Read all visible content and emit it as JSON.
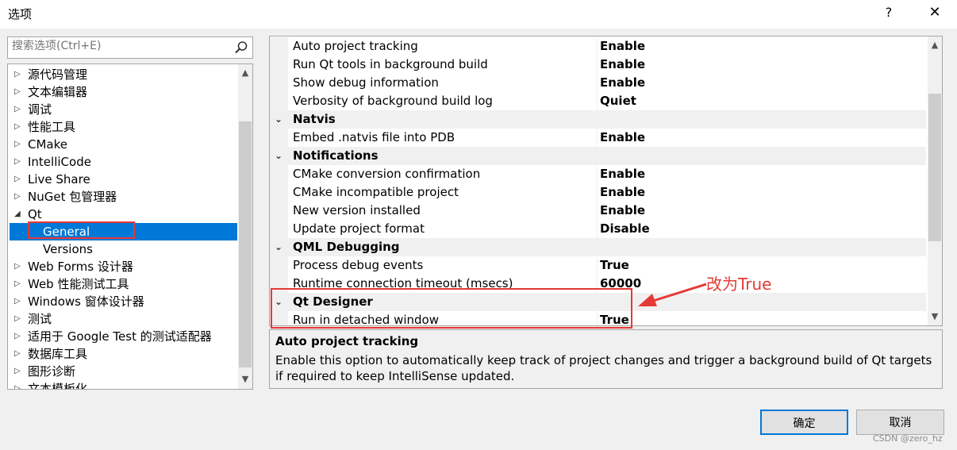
{
  "window": {
    "title": "选项",
    "help_label": "?",
    "close_label": "✕"
  },
  "search": {
    "placeholder": "搜索选项(Ctrl+E)",
    "icon": "search-icon"
  },
  "tree": {
    "items": [
      {
        "label": "源代码管理",
        "expanded": false
      },
      {
        "label": "文本编辑器",
        "expanded": false
      },
      {
        "label": "调试",
        "expanded": false
      },
      {
        "label": "性能工具",
        "expanded": false
      },
      {
        "label": "CMake",
        "expanded": false
      },
      {
        "label": "IntelliCode",
        "expanded": false
      },
      {
        "label": "Live Share",
        "expanded": false
      },
      {
        "label": "NuGet 包管理器",
        "expanded": false
      },
      {
        "label": "Qt",
        "expanded": true
      },
      {
        "label": "General",
        "child": true,
        "selected": true
      },
      {
        "label": "Versions",
        "child": true
      },
      {
        "label": "Web Forms 设计器",
        "expanded": false
      },
      {
        "label": "Web 性能测试工具",
        "expanded": false
      },
      {
        "label": "Windows 窗体设计器",
        "expanded": false
      },
      {
        "label": "测试",
        "expanded": false
      },
      {
        "label": "适用于 Google Test 的测试适配器",
        "expanded": false
      },
      {
        "label": "数据库工具",
        "expanded": false
      },
      {
        "label": "图形诊断",
        "expanded": false
      },
      {
        "label": "文本模板化",
        "expanded": false
      }
    ]
  },
  "properties": {
    "rows": [
      {
        "type": "prop",
        "name": "Auto project tracking",
        "value": "Enable"
      },
      {
        "type": "prop",
        "name": "Run Qt tools in background build",
        "value": "Enable"
      },
      {
        "type": "prop",
        "name": "Show debug information",
        "value": "Enable"
      },
      {
        "type": "prop",
        "name": "Verbosity of background build log",
        "value": "Quiet"
      },
      {
        "type": "category",
        "name": "Natvis"
      },
      {
        "type": "prop",
        "name": "Embed .natvis file into PDB",
        "value": "Enable"
      },
      {
        "type": "category",
        "name": "Notifications"
      },
      {
        "type": "prop",
        "name": "CMake conversion confirmation",
        "value": "Enable"
      },
      {
        "type": "prop",
        "name": "CMake incompatible project",
        "value": "Enable"
      },
      {
        "type": "prop",
        "name": "New version installed",
        "value": "Enable"
      },
      {
        "type": "prop",
        "name": "Update project format",
        "value": "Disable"
      },
      {
        "type": "category",
        "name": "QML Debugging"
      },
      {
        "type": "prop",
        "name": "Process debug events",
        "value": "True"
      },
      {
        "type": "prop",
        "name": "Runtime connection timeout (msecs)",
        "value": "60000"
      },
      {
        "type": "category",
        "name": "Qt Designer"
      },
      {
        "type": "prop",
        "name": "Run in detached window",
        "value": "True"
      }
    ]
  },
  "description": {
    "title": "Auto project tracking",
    "text": "Enable this option to automatically keep track of project changes and trigger a background build of Qt targets if required to keep IntelliSense updated."
  },
  "annotation": {
    "text": "改为True",
    "color": "#e53935"
  },
  "buttons": {
    "ok_label": "确定",
    "cancel_label": "取消"
  },
  "watermark": "CSDN @zero_hz",
  "colors": {
    "selection": "#0078d7",
    "annotation": "#e53935"
  }
}
